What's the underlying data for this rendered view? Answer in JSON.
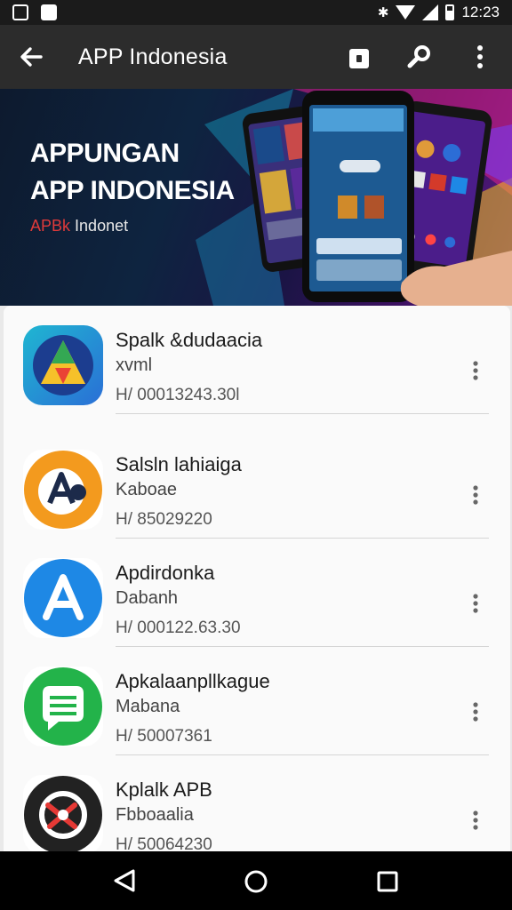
{
  "status_bar": {
    "time": "12:23",
    "bluetooth": "✱"
  },
  "app_bar": {
    "title": "APP Indonesia"
  },
  "banner": {
    "title_line1": "APPUNGAN",
    "title_line2": "APP INDONESIA",
    "sub_brand": "APBk",
    "sub_rest": "Indonet"
  },
  "apps": [
    {
      "name": "Spalk &dudaacia",
      "sub1": "xvml",
      "sub2": "H/ 00013243.30l",
      "icon": "play-triangle-icon",
      "color": "#2a6fd6"
    },
    {
      "name": "Salsln lahiaiga",
      "sub1": "Kaboae",
      "sub2": "H/ 85029220",
      "icon": "letter-a-badge-icon",
      "color": "#f39a1e"
    },
    {
      "name": "Apdirdonka",
      "sub1": "Dabanh",
      "sub2": "H/ 000122.63.30",
      "icon": "app-store-a-icon",
      "color": "#1e88e5"
    },
    {
      "name": "Apkalaanpllkague",
      "sub1": "Mabana",
      "sub2": "H/ 50007361",
      "icon": "chat-bubble-icon",
      "color": "#23b34a"
    },
    {
      "name": "Kplalk APB",
      "sub1": "Fbboaalia",
      "sub2": "H/ 50064230",
      "icon": "scissors-logo-icon",
      "color": "#222222"
    }
  ],
  "colors": {
    "app_bar": "#2c2c2c",
    "status_bar": "#1b1b1b",
    "nav_bar": "#000000",
    "list_bg": "#fafafa"
  }
}
